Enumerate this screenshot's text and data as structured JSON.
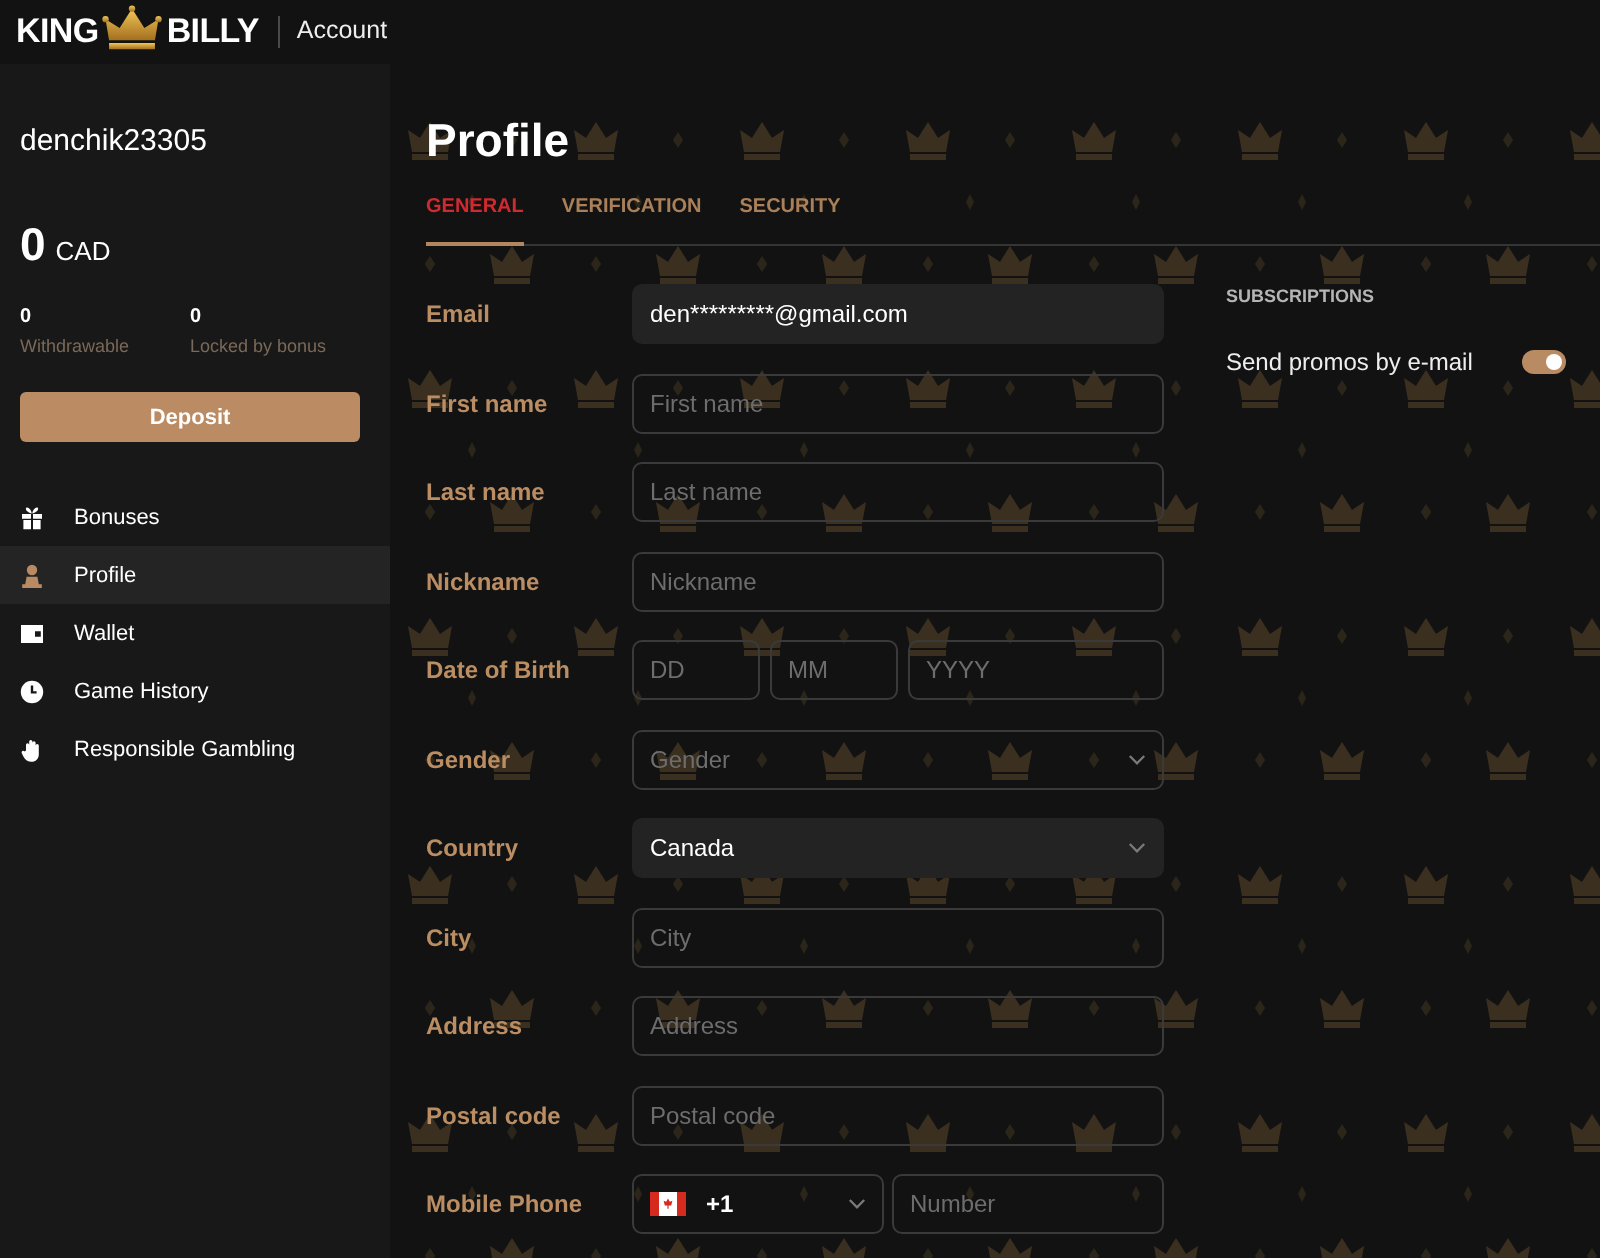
{
  "header": {
    "logo": [
      "KING",
      "BILLY"
    ],
    "section": "Account"
  },
  "sidebar": {
    "username": "denchik23305",
    "balance": {
      "amount": "0",
      "currency": "CAD"
    },
    "stats": [
      {
        "value": "0",
        "label": "Withdrawable"
      },
      {
        "value": "0",
        "label": "Locked by bonus"
      }
    ],
    "deposit_button": "Deposit",
    "menu": [
      {
        "label": "Bonuses",
        "selected": false
      },
      {
        "label": "Profile",
        "selected": true
      },
      {
        "label": "Wallet",
        "selected": false
      },
      {
        "label": "Game History",
        "selected": false
      },
      {
        "label": "Responsible Gambling",
        "selected": false
      }
    ]
  },
  "page": {
    "title": "Profile",
    "tabs": [
      {
        "label": "GENERAL",
        "selected": true
      },
      {
        "label": "VERIFICATION",
        "selected": false
      },
      {
        "label": "SECURITY",
        "selected": false
      }
    ],
    "fields": [
      {
        "label": "Email",
        "kind": "single",
        "inputs": [
          {
            "kind": "text",
            "value": "den*********@gmail.com",
            "disabled": true
          }
        ]
      },
      {
        "label": "First name",
        "kind": "single",
        "inputs": [
          {
            "kind": "text",
            "placeholder": "First name",
            "disabled": false
          }
        ]
      },
      {
        "label": "Last name",
        "kind": "single",
        "inputs": [
          {
            "kind": "text",
            "placeholder": "Last name",
            "disabled": false
          }
        ]
      },
      {
        "label": "Nickname",
        "kind": "single",
        "inputs": [
          {
            "kind": "text",
            "placeholder": "Nickname",
            "disabled": false
          }
        ]
      },
      {
        "label": "Date of Birth",
        "kind": "date",
        "inputs": [
          {
            "kind": "text",
            "placeholder": "DD",
            "disabled": false
          },
          {
            "kind": "text",
            "placeholder": "MM",
            "disabled": false
          },
          {
            "kind": "text",
            "placeholder": "YYYY",
            "disabled": false
          }
        ]
      },
      {
        "label": "Gender",
        "kind": "single",
        "inputs": [
          {
            "kind": "select",
            "placeholder": "Gender",
            "disabled": false
          }
        ]
      },
      {
        "label": "Country",
        "kind": "single",
        "inputs": [
          {
            "kind": "select",
            "value": "Canada",
            "disabled": true
          }
        ]
      },
      {
        "label": "City",
        "kind": "single",
        "inputs": [
          {
            "kind": "text",
            "placeholder": "City",
            "disabled": false
          }
        ]
      },
      {
        "label": "Address",
        "kind": "single",
        "inputs": [
          {
            "kind": "text",
            "placeholder": "Address",
            "disabled": false
          }
        ]
      },
      {
        "label": "Postal code",
        "kind": "single",
        "inputs": [
          {
            "kind": "text",
            "placeholder": "Postal code",
            "disabled": false
          }
        ]
      },
      {
        "label": "Mobile Phone",
        "kind": "phone",
        "inputs": [
          {
            "kind": "select",
            "value": "+1",
            "disabled": false
          },
          {
            "kind": "text",
            "placeholder": "Number",
            "disabled": false
          }
        ]
      }
    ],
    "subscriptions": {
      "title": "SUBSCRIPTIONS",
      "items": [
        {
          "label": "Send promos by e-mail",
          "on": true
        }
      ]
    }
  }
}
